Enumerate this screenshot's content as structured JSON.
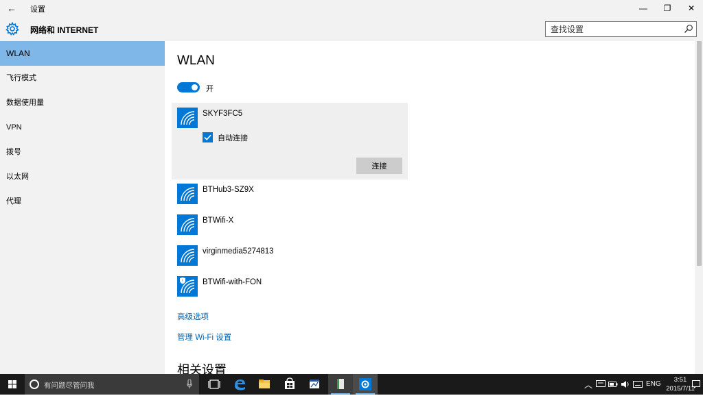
{
  "titlebar": {
    "title": "设置",
    "back": "←",
    "minimize": "—",
    "restore": "❐",
    "close": "✕"
  },
  "header": {
    "title": "网络和 INTERNET",
    "search_placeholder": "查找设置"
  },
  "sidebar": {
    "items": [
      {
        "label": "WLAN",
        "active": true
      },
      {
        "label": "飞行模式"
      },
      {
        "label": "数据使用量"
      },
      {
        "label": "VPN"
      },
      {
        "label": "拨号"
      },
      {
        "label": "以太网"
      },
      {
        "label": "代理"
      }
    ]
  },
  "main": {
    "title": "WLAN",
    "toggle_label": "开",
    "toggle_on": true,
    "selected_network": {
      "name": "SKYF3FC5",
      "auto_connect_label": "自动连接",
      "auto_connect_checked": true,
      "connect_label": "连接"
    },
    "networks": [
      {
        "name": "BTHub3-SZ9X",
        "secured": false
      },
      {
        "name": "BTWifi-X",
        "secured": false
      },
      {
        "name": "virginmedia5274813",
        "secured": false
      },
      {
        "name": "BTWifi-with-FON",
        "secured": true
      }
    ],
    "links": {
      "advanced": "高级选项",
      "manage_wifi": "管理 Wi-Fi 设置"
    },
    "related_title": "相关设置"
  },
  "taskbar": {
    "search_placeholder": "有问题尽管问我",
    "tray": {
      "language": "ENG",
      "time": "3:51",
      "date": "2015/7/11"
    }
  },
  "colors": {
    "accent": "#0078d7",
    "sidebar_active": "#7fb7e8",
    "link": "#0063b1"
  }
}
